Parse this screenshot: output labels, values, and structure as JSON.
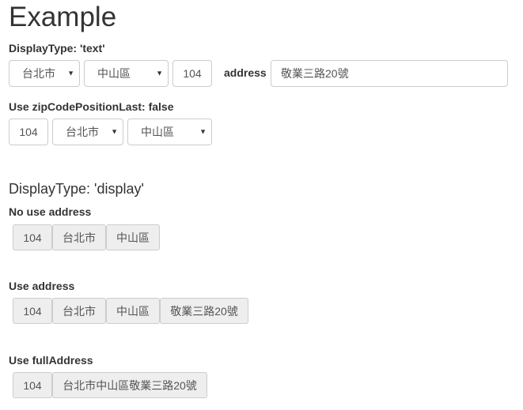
{
  "page": {
    "title": "Example"
  },
  "section_text": {
    "label": "DisplayType: 'text'",
    "county_select": "台北市",
    "district_select": "中山區",
    "zipcode": "104",
    "address_label": "address",
    "address_value": "敬業三路20號"
  },
  "section_zip_last": {
    "label": "Use zipCodePositionLast: false",
    "zipcode": "104",
    "county_select": "台北市",
    "district_select": "中山區"
  },
  "section_display": {
    "heading": "DisplayType: 'display'",
    "no_address": {
      "label": "No use address",
      "zipcode": "104",
      "county": "台北市",
      "district": "中山區"
    },
    "use_address": {
      "label": "Use address",
      "zipcode": "104",
      "county": "台北市",
      "district": "中山區",
      "address": "敬業三路20號"
    },
    "full_address": {
      "label": "Use fullAddress",
      "zipcode": "104",
      "full": "台北市中山區敬業三路20號"
    }
  },
  "icons": {
    "dropdown": "chevron-down-icon"
  },
  "colors": {
    "text": "#333333",
    "control_text": "#555555",
    "border": "#cccccc",
    "display_cell_bg": "#eeeeee"
  }
}
